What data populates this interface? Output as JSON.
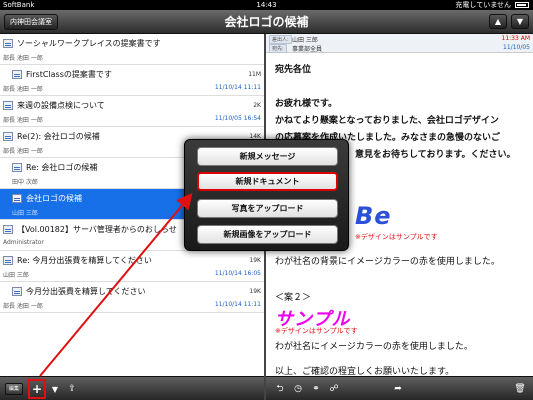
{
  "status": {
    "carrier": "SoftBank",
    "time": "14:43",
    "charging": "充電していません"
  },
  "nav": {
    "back_label": "内神田会議室",
    "title": "会社ロゴの候補",
    "up_icon": "▲",
    "down_icon": "▼"
  },
  "messages": [
    {
      "subject": "ソーシャルワークプレイスの提案書です",
      "sender": "部長 池田 一郎",
      "size": "",
      "date": "",
      "indent": 0,
      "selected": false
    },
    {
      "subject": "FirstClassの提案書です",
      "sender": "部長 池田 一郎",
      "size": "11M",
      "date": "11/10/14 11:11",
      "indent": 1,
      "selected": false
    },
    {
      "subject": "来週の設備点検について",
      "sender": "部長 池田 一郎",
      "size": "2K",
      "date": "11/10/05 16:54",
      "indent": 0,
      "selected": false
    },
    {
      "subject": "Re(2): 会社ロゴの候補",
      "sender": "部長 池田 一郎",
      "size": "14K",
      "date": "",
      "indent": 0,
      "selected": false
    },
    {
      "subject": "Re: 会社ロゴの候補",
      "sender": "田中 次郎",
      "size": "",
      "date": "",
      "indent": 1,
      "selected": false
    },
    {
      "subject": "会社ロゴの候補",
      "sender": "山田 三郎",
      "size": "",
      "date": "",
      "indent": 1,
      "selected": true
    },
    {
      "subject": "【Vol.00182】サーバ管理者からのおしらせ",
      "sender": "Administrator",
      "size": "",
      "date": "",
      "indent": 0,
      "selected": false
    },
    {
      "subject": "Re: 今月分出張費を精算してください",
      "sender": "山田 三郎",
      "size": "19K",
      "date": "11/10/14 16:05",
      "indent": 0,
      "selected": false
    },
    {
      "subject": "今月分出張費を精算してください",
      "sender": "部長 池田 一郎",
      "size": "19K",
      "date": "11/10/14 11:11",
      "indent": 1,
      "selected": false
    }
  ],
  "toolbar": {
    "edit_label": "編集",
    "plus": "+",
    "filter": "▼",
    "folder": "⇪"
  },
  "detail": {
    "from_label": "差出人:",
    "from_value": "山田 三郎",
    "to_label": "宛先:",
    "to_value": "事業部全員",
    "date": "11/10/05",
    "time": "11:33 AM",
    "lines": [
      "宛先各位",
      "お疲れ様です。",
      "かねてより懸案となっておりました、会社ロゴデザイン",
      "の応募案を作成いたしました。みなさまの急慢のないご",
      "意見をお待ちしております。ください。",
      "わが社名の背景にイメージカラーの赤を使用しました。",
      "＜案２＞",
      "わが社名にイメージカラーの赤を使用しました。",
      "以上、ご確認の程宜しくお願いいたします。"
    ],
    "sample_logo": "サンプル",
    "sample_note": "※デザインはサンプルです"
  },
  "popup": {
    "items": [
      "新規メッセージ",
      "新規ドキュメント",
      "写真をアップロード",
      "新規画像をアップロード"
    ]
  },
  "colors": {
    "selection": "#1770e8",
    "highlight_frame": "#e01010"
  }
}
